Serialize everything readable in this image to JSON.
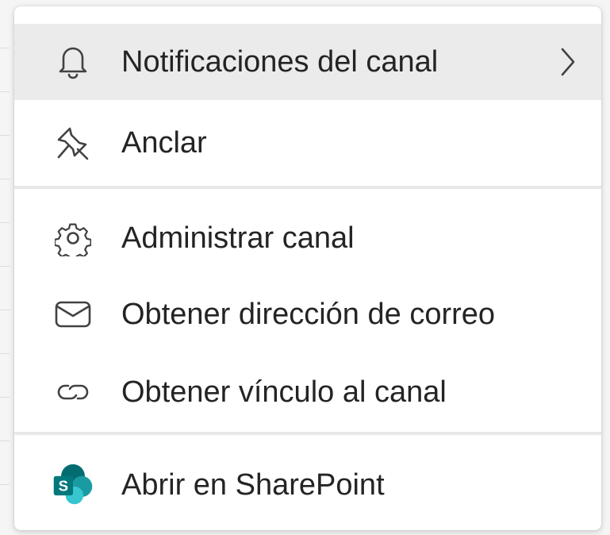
{
  "menu": {
    "groups": [
      {
        "items": [
          {
            "label": "Notificaciones del canal",
            "icon": "bell-icon",
            "has_submenu": true,
            "hovered": true
          },
          {
            "label": "Anclar",
            "icon": "pin-icon",
            "has_submenu": false,
            "hovered": false
          }
        ]
      },
      {
        "items": [
          {
            "label": "Administrar canal",
            "icon": "gear-icon",
            "has_submenu": false,
            "hovered": false
          },
          {
            "label": "Obtener dirección de correo",
            "icon": "envelope-icon",
            "has_submenu": false,
            "hovered": false
          },
          {
            "label": "Obtener vínculo al canal",
            "icon": "link-icon",
            "has_submenu": false,
            "hovered": false
          }
        ]
      },
      {
        "items": [
          {
            "label": "Abrir en SharePoint",
            "icon": "sharepoint-icon",
            "has_submenu": false,
            "hovered": false
          }
        ]
      }
    ]
  },
  "sharepoint_logo_letter": "S",
  "colors": {
    "hover_bg": "#ebebeb",
    "text": "#242424",
    "icon_stroke": "#424242",
    "sharepoint_dark": "#036c70",
    "sharepoint_mid": "#1a9ba1",
    "sharepoint_light": "#37c6d0"
  }
}
